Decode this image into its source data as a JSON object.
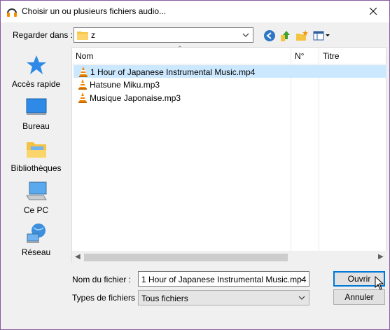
{
  "window": {
    "title": "Choisir un ou plusieurs fichiers audio..."
  },
  "lookin": {
    "label": "Regarder dans :",
    "value": "z"
  },
  "places": [
    {
      "label": "Accès rapide",
      "icon": "star-icon"
    },
    {
      "label": "Bureau",
      "icon": "desktop-icon"
    },
    {
      "label": "Bibliothèques",
      "icon": "libraries-icon"
    },
    {
      "label": "Ce PC",
      "icon": "computer-icon"
    },
    {
      "label": "Réseau",
      "icon": "network-icon"
    }
  ],
  "filelist": {
    "columns": [
      "Nom",
      "N°",
      "Titre"
    ],
    "rows": [
      {
        "name": "1 Hour of Japanese Instrumental Music.mp4",
        "selected": true
      },
      {
        "name": "Hatsune Miku.mp3",
        "selected": false
      },
      {
        "name": "Musique Japonaise.mp3",
        "selected": false
      }
    ]
  },
  "filename": {
    "label": "Nom du fichier :",
    "value": "1 Hour of Japanese Instrumental Music.mp4"
  },
  "filetype": {
    "label": "Types de fichiers :",
    "value": "Tous fichiers"
  },
  "buttons": {
    "open": "Ouvrir",
    "cancel": "Annuler"
  },
  "colors": {
    "selection": "#cce8ff",
    "accent": "#0078d7",
    "window_border": "#8a5a9e"
  }
}
